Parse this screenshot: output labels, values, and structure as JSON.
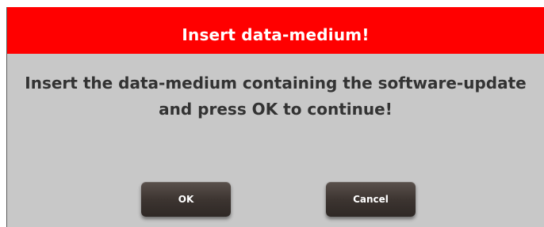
{
  "dialog": {
    "title": "Insert data-medium!",
    "message_line1": "Insert the data-medium containing the software-update",
    "message_line2": "and press OK to continue!",
    "buttons": {
      "ok_label": "OK",
      "cancel_label": "Cancel"
    }
  },
  "colors": {
    "title_bar": "#ff0000",
    "dialog_background": "#c8c8c8",
    "button_background": "#3d3531",
    "message_text": "#333333"
  }
}
